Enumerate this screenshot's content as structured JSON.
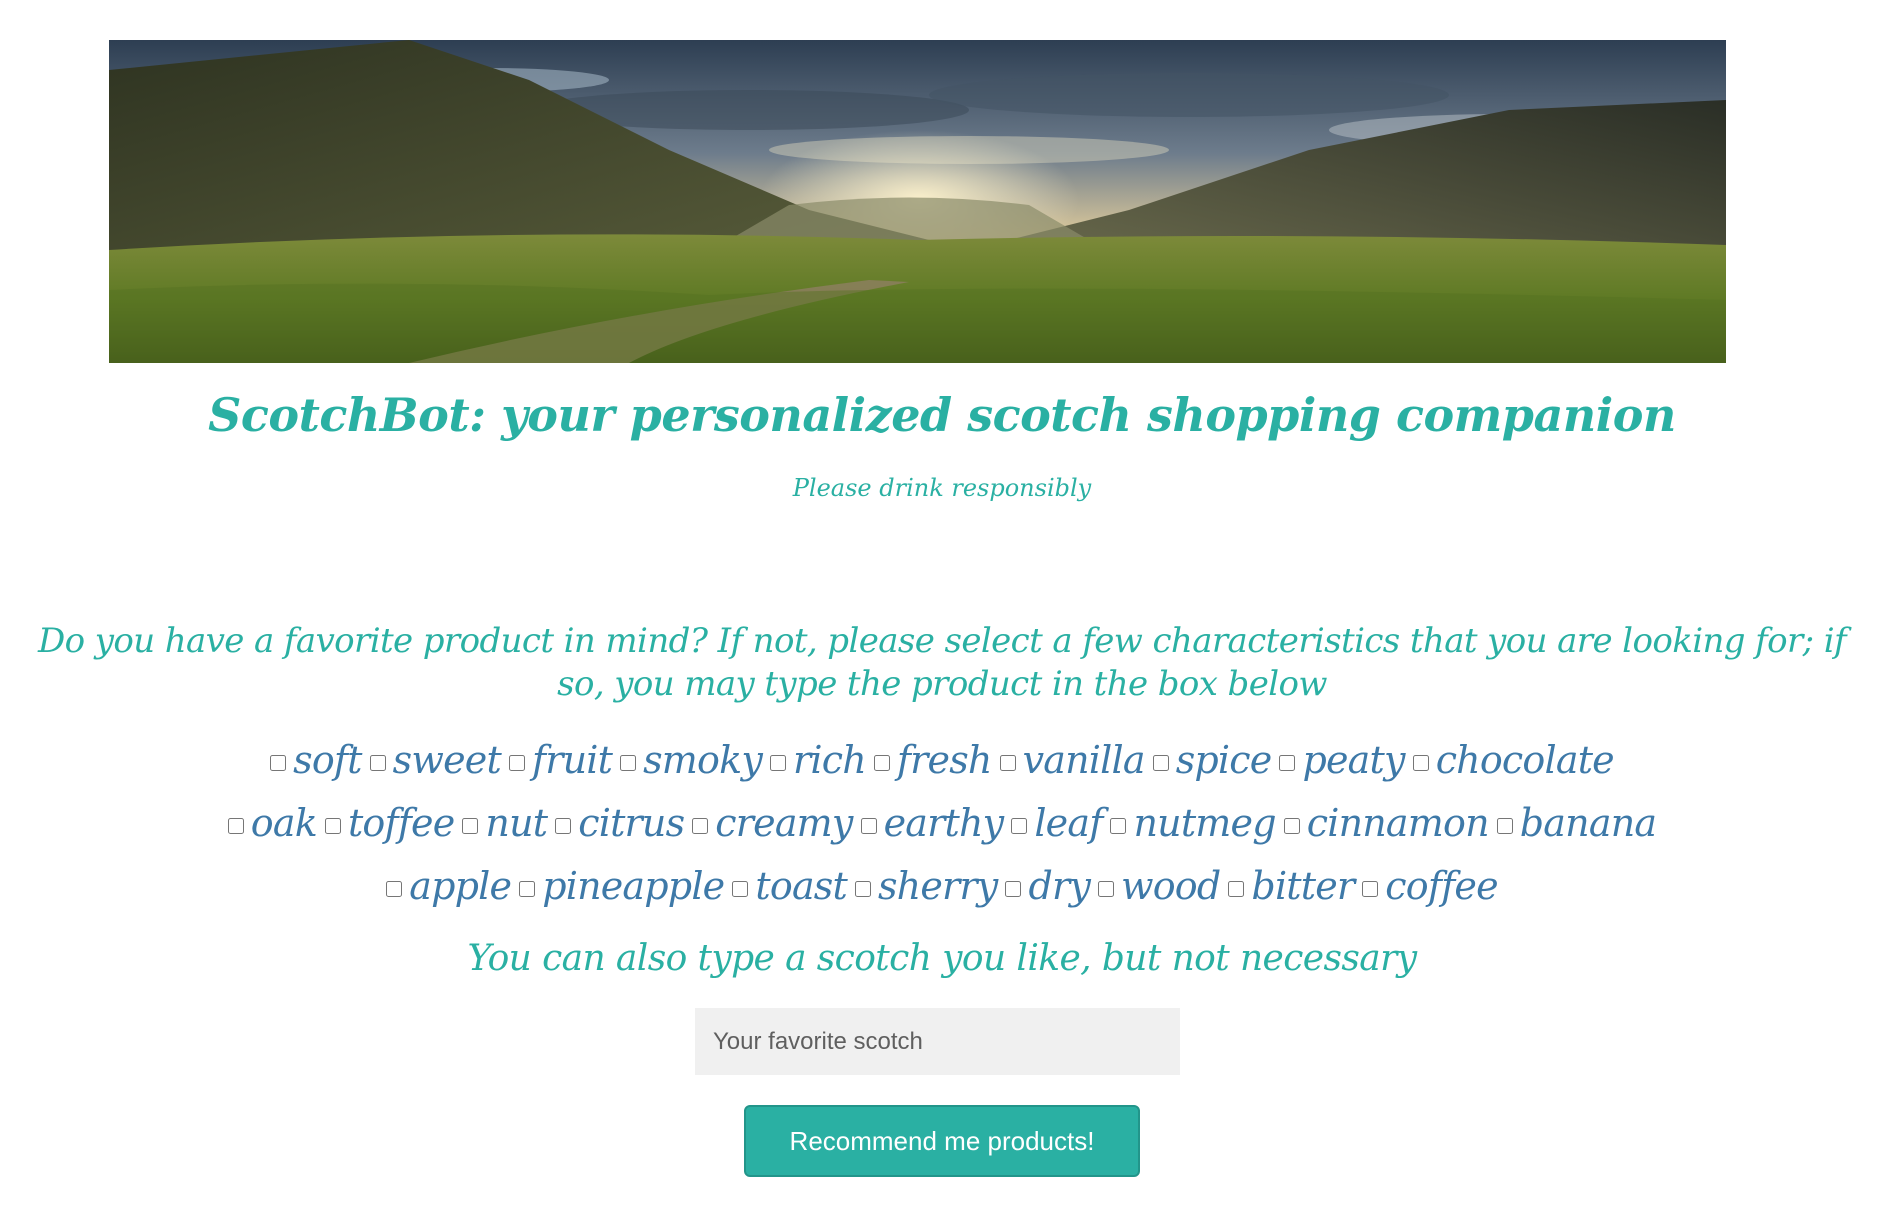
{
  "hero": {
    "image_description_name": "highland-landscape-banner"
  },
  "header": {
    "title": "ScotchBot: your personalized scotch shopping companion",
    "subtitle": "Please drink responsibly"
  },
  "form": {
    "question": "Do you have a favorite product in mind? If not, please select a few characteristics that you are looking for; if so, you may type the product in the box below",
    "characteristics_rows": [
      [
        "soft",
        "sweet",
        "fruit",
        "smoky",
        "rich",
        "fresh",
        "vanilla",
        "spice",
        "peaty",
        "chocolate"
      ],
      [
        "oak",
        "toffee",
        "nut",
        "citrus",
        "creamy",
        "earthy",
        "leaf",
        "nutmeg",
        "cinnamon",
        "banana"
      ],
      [
        "apple",
        "pineapple",
        "toast",
        "sherry",
        "dry",
        "wood",
        "bitter",
        "coffee"
      ]
    ],
    "also_type_label": "You can also type a scotch you like, but not necessary",
    "scotch_input": {
      "value": "",
      "placeholder": "Your favorite scotch"
    },
    "submit_label": "Recommend me products!"
  },
  "colors": {
    "accent_teal": "#2ab0a3",
    "checkbox_label_blue": "#3e79a8",
    "input_background": "#f0f0f0"
  }
}
